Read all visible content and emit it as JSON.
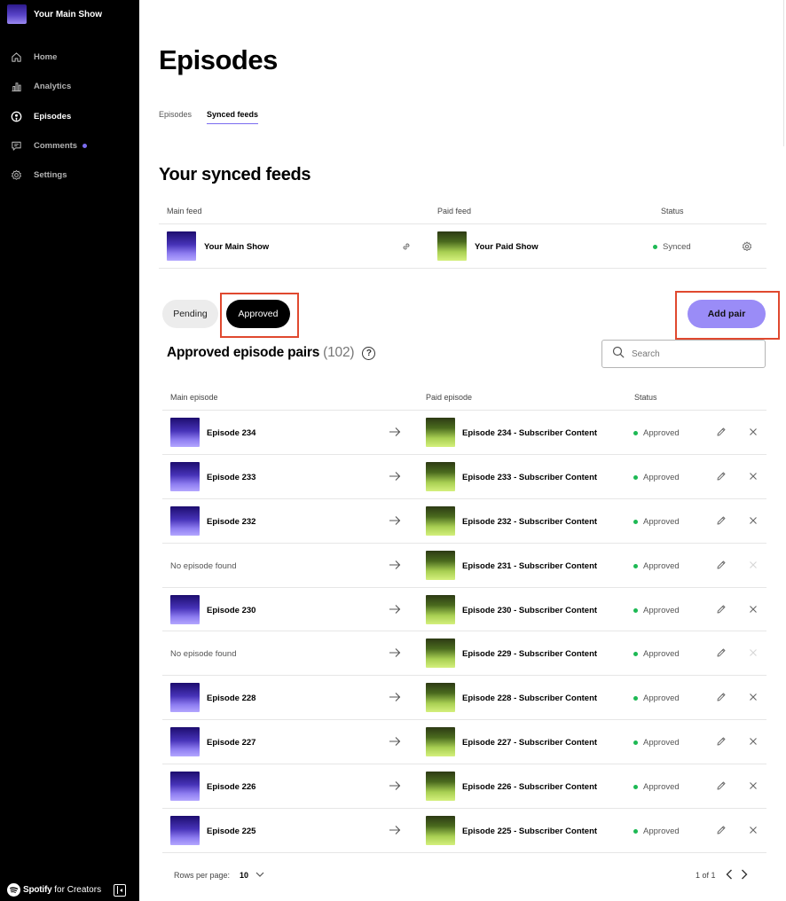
{
  "sidebar": {
    "show_title": "Your Main Show",
    "nav": [
      {
        "label": "Home",
        "icon": "home-icon"
      },
      {
        "label": "Analytics",
        "icon": "analytics-icon"
      },
      {
        "label": "Episodes",
        "icon": "episodes-icon",
        "active": true
      },
      {
        "label": "Comments",
        "icon": "comments-icon",
        "badge": true
      },
      {
        "label": "Settings",
        "icon": "gear-icon"
      }
    ],
    "brand_name": "Spotify",
    "brand_suffix": "for Creators"
  },
  "header": {
    "title": "Episodes",
    "tabs": [
      "Episodes",
      "Synced feeds"
    ],
    "active_tab": "Synced feeds"
  },
  "synced_feeds": {
    "title": "Your synced feeds",
    "columns": [
      "Main feed",
      "Paid feed",
      "Status"
    ],
    "row": {
      "main": "Your Main Show",
      "paid": "Your Paid Show",
      "status": "Synced"
    }
  },
  "filters": {
    "pending": "Pending",
    "approved": "Approved",
    "add_pair": "Add pair"
  },
  "pairs": {
    "title": "Approved episode pairs",
    "count": "(102)",
    "search_placeholder": "Search",
    "columns": [
      "Main episode",
      "Paid episode",
      "Status"
    ],
    "rows": [
      {
        "main": "Episode 234",
        "paid": "Episode 234 - Subscriber Content",
        "status": "Approved",
        "has_main": true
      },
      {
        "main": "Episode 233",
        "paid": "Episode 233 - Subscriber Content",
        "status": "Approved",
        "has_main": true
      },
      {
        "main": "Episode 232",
        "paid": "Episode 232 - Subscriber Content",
        "status": "Approved",
        "has_main": true
      },
      {
        "main": "No episode found",
        "paid": "Episode 231 - Subscriber Content",
        "status": "Approved",
        "has_main": false
      },
      {
        "main": "Episode 230",
        "paid": "Episode 230 - Subscriber Content",
        "status": "Approved",
        "has_main": true
      },
      {
        "main": "No episode found",
        "paid": "Episode 229 - Subscriber Content",
        "status": "Approved",
        "has_main": false
      },
      {
        "main": "Episode 228",
        "paid": "Episode 228 - Subscriber Content",
        "status": "Approved",
        "has_main": true
      },
      {
        "main": "Episode 227",
        "paid": "Episode 227 - Subscriber Content",
        "status": "Approved",
        "has_main": true
      },
      {
        "main": "Episode 226",
        "paid": "Episode 226 - Subscriber Content",
        "status": "Approved",
        "has_main": true
      },
      {
        "main": "Episode 225",
        "paid": "Episode 225 - Subscriber Content",
        "status": "Approved",
        "has_main": true
      }
    ]
  },
  "pagination": {
    "rows_label": "Rows per page:",
    "rows_value": "10",
    "page_info": "1 of 1"
  },
  "colors": {
    "accent": "#9a8cf7",
    "status_green": "#1db954",
    "highlight": "#e0492f"
  }
}
